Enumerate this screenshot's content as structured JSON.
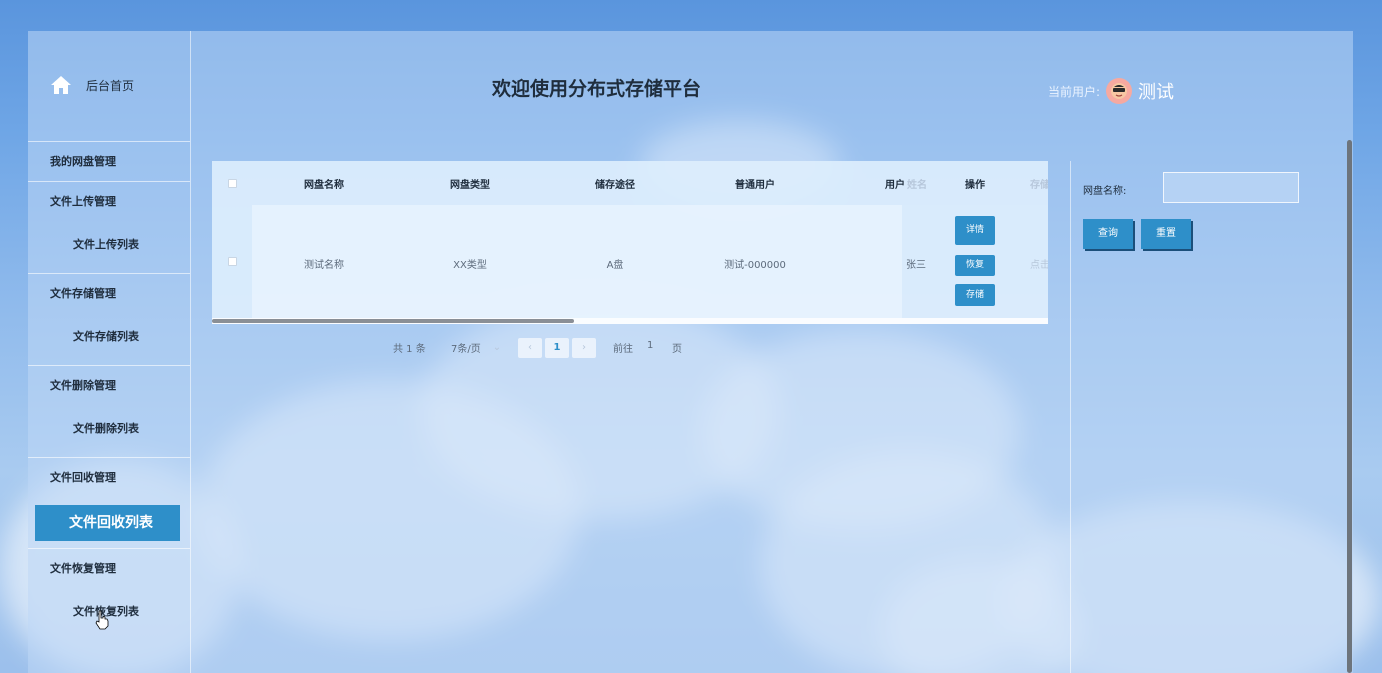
{
  "sidebar": {
    "home_label": "后台首页",
    "groups": [
      {
        "title": "我的网盘管理",
        "items": []
      },
      {
        "title": "文件上传管理",
        "items": [
          "文件上传列表"
        ]
      },
      {
        "title": "文件存储管理",
        "items": [
          "文件存储列表"
        ]
      },
      {
        "title": "文件删除管理",
        "items": [
          "文件删除列表"
        ]
      },
      {
        "title": "文件回收管理",
        "items": [
          "文件回收列表"
        ]
      },
      {
        "title": "文件恢复管理",
        "items": [
          "文件恢复列表"
        ]
      }
    ],
    "active_item": "文件回收列表"
  },
  "header": {
    "title": "欢迎使用分布式存储平台",
    "current_user_label": "当前用户:",
    "user_name": "测试"
  },
  "table": {
    "columns": [
      "网盘名称",
      "网盘类型",
      "储存途径",
      "普通用户",
      "用户",
      "操作"
    ],
    "hidden_col_fragment": "姓名",
    "right_fragment": "存储",
    "rows": [
      {
        "name": "测试名称",
        "type": "XX类型",
        "path": "A盘",
        "user": "测试-000000",
        "username": "张三",
        "right_fragment": "点击"
      }
    ],
    "actions": [
      "详情",
      "恢复",
      "存储"
    ]
  },
  "pagination": {
    "total": "共 1 条",
    "page_size": "7条/页",
    "current_page": "1",
    "goto_label": "前往",
    "goto_value": "1",
    "page_suffix": "页"
  },
  "filter": {
    "label": "网盘名称:",
    "input_value": "",
    "search_button": "查询",
    "reset_button": "重置"
  },
  "colors": {
    "accent": "#2e8fc9",
    "sky": "#5a95dd"
  }
}
